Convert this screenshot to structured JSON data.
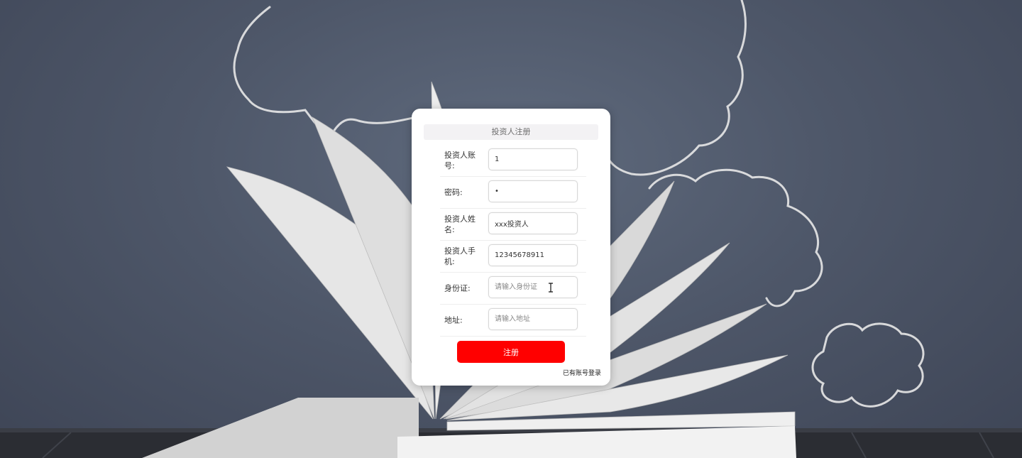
{
  "form": {
    "title": "投资人注册",
    "fields": [
      {
        "label": "投资人账号:",
        "value": "1",
        "placeholder": ""
      },
      {
        "label": "密码:",
        "value": "•",
        "placeholder": ""
      },
      {
        "label": "投资人姓名:",
        "value": "xxx投资人",
        "placeholder": ""
      },
      {
        "label": "投资人手机:",
        "value": "12345678911",
        "placeholder": ""
      },
      {
        "label": "身份证:",
        "value": "",
        "placeholder": "请输入身份证"
      },
      {
        "label": "地址:",
        "value": "",
        "placeholder": "请输入地址"
      }
    ],
    "submit_label": "注册",
    "login_link": "已有账号登录"
  },
  "colors": {
    "accent": "#ff0000",
    "background": "#4e5769"
  },
  "icons": {
    "cursor": "text-cursor-icon"
  }
}
